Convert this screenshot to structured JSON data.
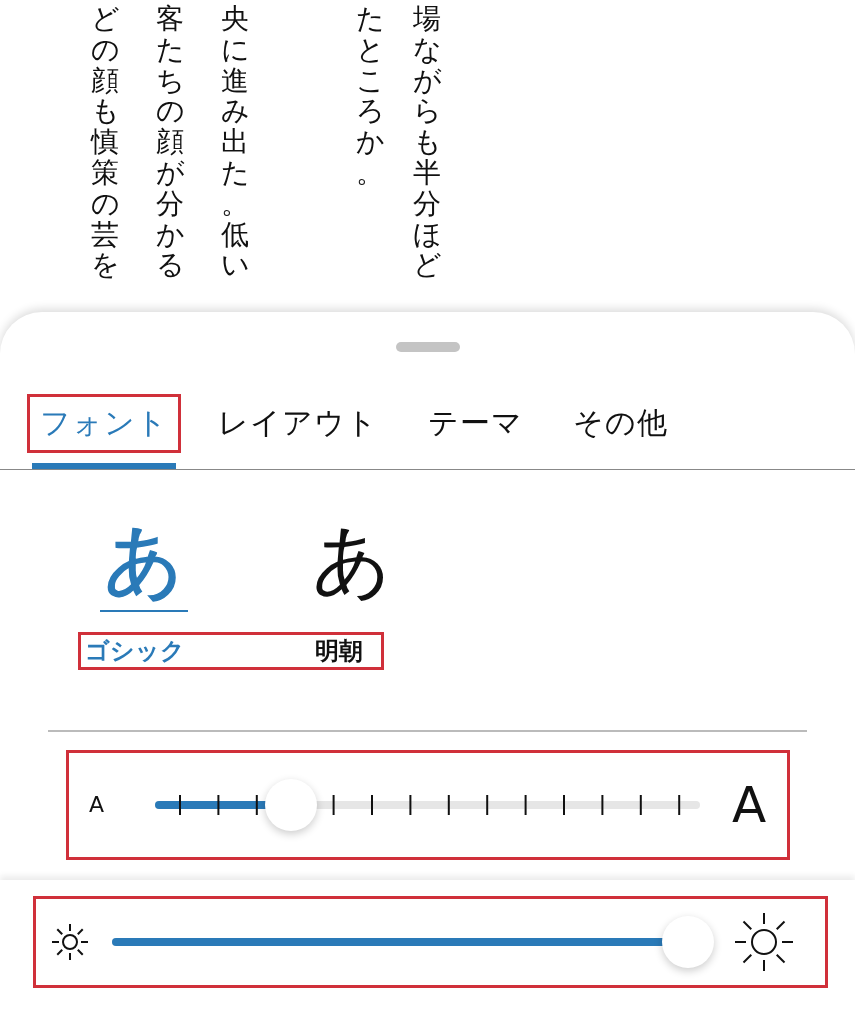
{
  "reader_text": {
    "paragraphs": [
      {
        "columns": [
          "どの顔も慎策の芸を",
          "客たちの顔が分かる",
          "央に進み出た。低い"
        ]
      },
      {
        "columns": [
          "たところか。",
          "場ながらも半分ほど"
        ]
      }
    ]
  },
  "settings_sheet": {
    "tabs": [
      {
        "label": "フォント",
        "selected": true,
        "highlighted": true
      },
      {
        "label": "レイアウト",
        "selected": false,
        "highlighted": false
      },
      {
        "label": "テーマ",
        "selected": false,
        "highlighted": false
      },
      {
        "label": "その他",
        "selected": false,
        "highlighted": false
      }
    ],
    "fonts": {
      "highlighted": true,
      "options": [
        {
          "sample": "あ",
          "label": "ゴシック",
          "kind": "gothic",
          "selected": true
        },
        {
          "sample": "あ",
          "label": "明朝",
          "kind": "mincho",
          "selected": false
        }
      ]
    },
    "font_size": {
      "min_label": "A",
      "max_label": "A",
      "level": 0.25,
      "highlighted": true
    },
    "brightness": {
      "level": 0.98,
      "highlighted": true
    }
  }
}
